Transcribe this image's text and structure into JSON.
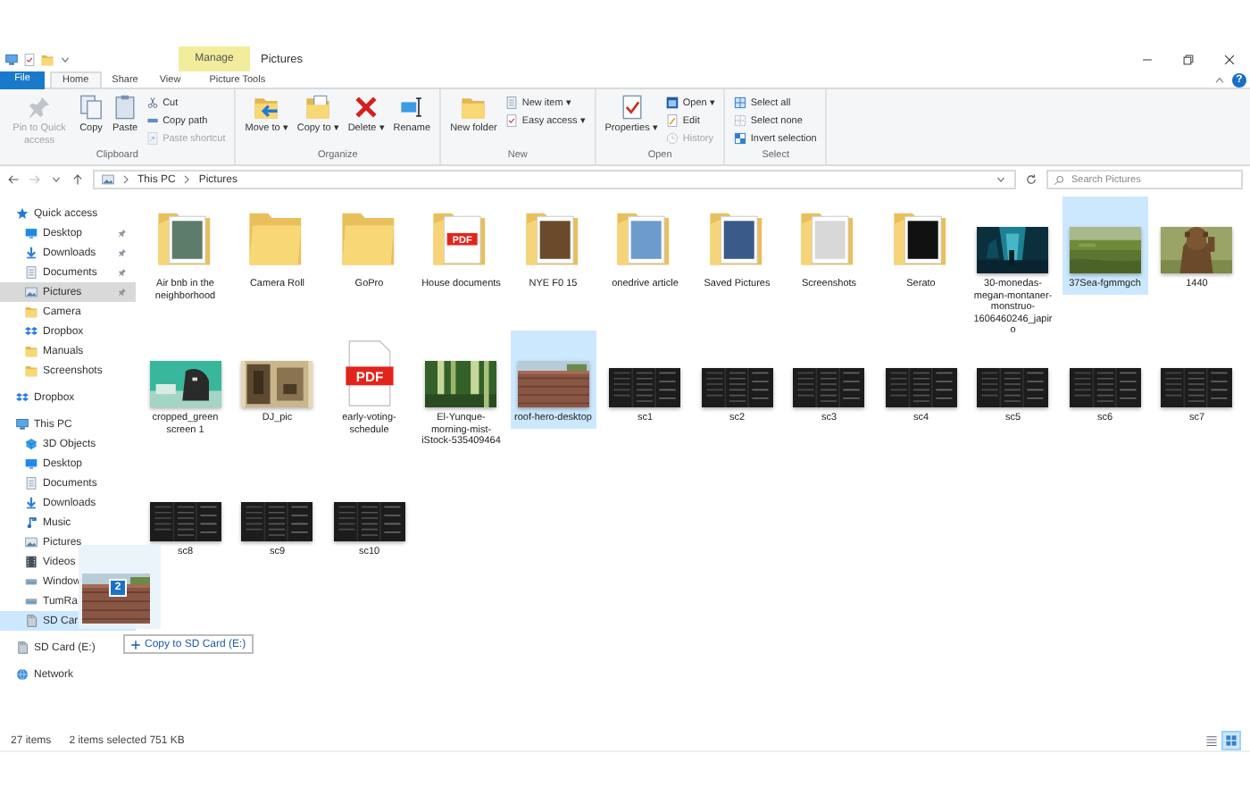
{
  "window": {
    "context_label": "Manage",
    "title": "Pictures",
    "help": "?"
  },
  "tabs": [
    {
      "label": "File",
      "kind": "file",
      "selected": false
    },
    {
      "label": "Home",
      "kind": "tab",
      "selected": true
    },
    {
      "label": "Share",
      "kind": "tab",
      "selected": false
    },
    {
      "label": "View",
      "kind": "tab",
      "selected": false
    },
    {
      "label": "Picture Tools",
      "kind": "context",
      "selected": false
    }
  ],
  "ribbon": [
    {
      "group": "Clipboard",
      "large": [
        {
          "label": "Pin to Quick access",
          "disabled": true
        },
        {
          "label": "Copy",
          "disabled": false
        },
        {
          "label": "Paste",
          "disabled": false
        }
      ],
      "small": [
        {
          "label": "Cut",
          "disabled": false
        },
        {
          "label": "Copy path",
          "disabled": false
        },
        {
          "label": "Paste shortcut",
          "disabled": true
        }
      ]
    },
    {
      "group": "Organize",
      "large": [
        {
          "label": "Move to ▾",
          "disabled": false
        },
        {
          "label": "Copy to ▾",
          "disabled": false
        },
        {
          "label": "Delete ▾",
          "disabled": false
        },
        {
          "label": "Rename",
          "disabled": false
        }
      ]
    },
    {
      "group": "New",
      "large": [
        {
          "label": "New folder",
          "disabled": false
        }
      ],
      "small": [
        {
          "label": "New item ▾",
          "disabled": false
        },
        {
          "label": "Easy access ▾",
          "disabled": false
        }
      ]
    },
    {
      "group": "Open",
      "large": [
        {
          "label": "Properties ▾",
          "disabled": false
        }
      ],
      "small": [
        {
          "label": "Open ▾",
          "disabled": false
        },
        {
          "label": "Edit",
          "disabled": false
        },
        {
          "label": "History",
          "disabled": true
        }
      ]
    },
    {
      "group": "Select",
      "small": [
        {
          "label": "Select all",
          "disabled": false
        },
        {
          "label": "Select none",
          "disabled": false
        },
        {
          "label": "Invert selection",
          "disabled": false
        }
      ]
    }
  ],
  "address": {
    "path": [
      "This PC",
      "Pictures"
    ]
  },
  "search": {
    "placeholder": "Search Pictures"
  },
  "sidebar": {
    "items": [
      {
        "label": "Quick access",
        "selected": false,
        "drop_target": false,
        "children": [
          {
            "label": "Desktop",
            "selected": false,
            "pinned": true,
            "drop_target": false
          },
          {
            "label": "Downloads",
            "selected": false,
            "pinned": true,
            "drop_target": false
          },
          {
            "label": "Documents",
            "selected": false,
            "pinned": true,
            "drop_target": false
          },
          {
            "label": "Pictures",
            "selected": true,
            "pinned": true,
            "drop_target": false
          },
          {
            "label": "Camera",
            "selected": false,
            "pinned": false,
            "drop_target": false
          },
          {
            "label": "Dropbox",
            "selected": false,
            "pinned": false,
            "drop_target": false
          },
          {
            "label": "Manuals",
            "selected": false,
            "pinned": false,
            "drop_target": false
          },
          {
            "label": "Screenshots",
            "selected": false,
            "pinned": false,
            "drop_target": false
          }
        ]
      },
      {
        "label": "Dropbox",
        "selected": false,
        "drop_target": false
      },
      {
        "label": "This PC",
        "selected": false,
        "drop_target": false,
        "children": [
          {
            "label": "3D Objects",
            "selected": false,
            "pinned": false,
            "drop_target": false
          },
          {
            "label": "Desktop",
            "selected": false,
            "pinned": false,
            "drop_target": false
          },
          {
            "label": "Documents",
            "selected": false,
            "pinned": false,
            "drop_target": false
          },
          {
            "label": "Downloads",
            "selected": false,
            "pinned": false,
            "drop_target": false
          },
          {
            "label": "Music",
            "selected": false,
            "pinned": false,
            "drop_target": false
          },
          {
            "label": "Pictures",
            "selected": false,
            "pinned": false,
            "drop_target": false
          },
          {
            "label": "Videos",
            "selected": false,
            "pinned": false,
            "drop_target": false
          },
          {
            "label": "Window",
            "selected": false,
            "pinned": false,
            "drop_target": false
          },
          {
            "label": "TumRa",
            "selected": false,
            "pinned": false,
            "drop_target": false
          },
          {
            "label": "SD Car",
            "selected": false,
            "pinned": false,
            "drop_target": true
          }
        ]
      },
      {
        "label": "SD Card (E:)",
        "selected": false,
        "drop_target": false
      },
      {
        "label": "Network",
        "selected": false,
        "drop_target": false
      }
    ]
  },
  "files": [
    {
      "name": "Air bnb in the neighborhood",
      "kind": "folder-preview",
      "selected": false
    },
    {
      "name": "Camera Roll",
      "kind": "folder",
      "selected": false
    },
    {
      "name": "GoPro",
      "kind": "folder",
      "selected": false
    },
    {
      "name": "House documents",
      "kind": "folder-preview",
      "badge": "PDF",
      "selected": false
    },
    {
      "name": "NYE F0 15",
      "kind": "folder-preview",
      "selected": false
    },
    {
      "name": "onedrive article",
      "kind": "folder-preview",
      "selected": false
    },
    {
      "name": "Saved Pictures",
      "kind": "folder-preview",
      "selected": false
    },
    {
      "name": "Screenshots",
      "kind": "folder-preview",
      "selected": false
    },
    {
      "name": "Serato",
      "kind": "folder-preview",
      "selected": false
    },
    {
      "name": "30-monedas-megan-montaner-monstruo-1606460246_japiro",
      "selected": false
    },
    {
      "name": "37Sea-fgmmgch",
      "selected": true
    },
    {
      "name": "1440",
      "selected": false
    },
    {
      "name": "cropped_green screen 1",
      "selected": false
    },
    {
      "name": "DJ_pic",
      "selected": false
    },
    {
      "name": "early-voting-schedule",
      "kind": "pdf",
      "badge": "PDF",
      "selected": false
    },
    {
      "name": "El-Yunque-morning-mist-iStock-535409464",
      "selected": false
    },
    {
      "name": "roof-hero-desktop",
      "selected": true
    },
    {
      "name": "sc1",
      "kind": "screenshot",
      "selected": false
    },
    {
      "name": "sc2",
      "kind": "screenshot",
      "selected": false
    },
    {
      "name": "sc3",
      "kind": "screenshot",
      "selected": false
    },
    {
      "name": "sc4",
      "kind": "screenshot",
      "selected": false
    },
    {
      "name": "sc5",
      "kind": "screenshot",
      "selected": false
    },
    {
      "name": "sc6",
      "kind": "screenshot",
      "selected": false
    },
    {
      "name": "sc7",
      "kind": "screenshot",
      "selected": false
    },
    {
      "name": "sc8",
      "kind": "screenshot",
      "selected": false
    },
    {
      "name": "sc9",
      "kind": "screenshot",
      "selected": false
    },
    {
      "name": "sc10",
      "kind": "screenshot",
      "selected": false
    }
  ],
  "drag": {
    "count": "2",
    "tooltip": "Copy to SD Card (E:)"
  },
  "status_bar": {
    "items": "27 items",
    "selection": "2 items selected  751 KB",
    "views": [
      {
        "selected": false
      },
      {
        "selected": true
      }
    ]
  }
}
